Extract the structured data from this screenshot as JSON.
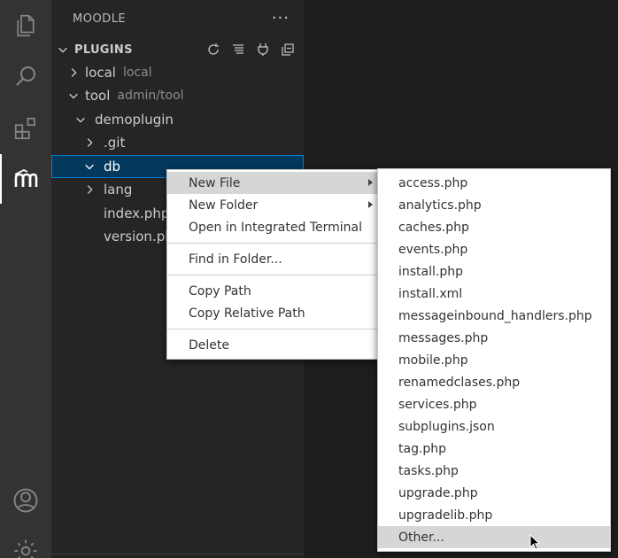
{
  "activity_bar": {
    "icons": [
      "explorer-icon",
      "search-icon",
      "extensions-icon",
      "moodle-icon",
      "account-icon",
      "settings-gear-icon"
    ]
  },
  "sidebar": {
    "title": "MOODLE",
    "more": "···",
    "section": {
      "title": "PLUGINS",
      "actions": [
        "refresh-icon",
        "collapse-all-icon",
        "plug-icon",
        "collapse-folders-icon"
      ]
    },
    "tree": [
      {
        "label": "local",
        "desc": "local"
      },
      {
        "label": "tool",
        "desc": "admin/tool"
      },
      {
        "label": "demoplugin",
        "desc": ""
      },
      {
        "label": ".git",
        "desc": ""
      },
      {
        "label": "db",
        "desc": ""
      },
      {
        "label": "lang",
        "desc": ""
      },
      {
        "label": "index.php",
        "desc": ""
      },
      {
        "label": "version.php",
        "desc": ""
      }
    ]
  },
  "context_menu": {
    "items": [
      {
        "label": "New File"
      },
      {
        "label": "New Folder"
      },
      {
        "label": "Open in Integrated Terminal"
      },
      {
        "label": "Find in Folder..."
      },
      {
        "label": "Copy Path"
      },
      {
        "label": "Copy Relative Path"
      },
      {
        "label": "Delete"
      }
    ]
  },
  "submenu": {
    "items": [
      "access.php",
      "analytics.php",
      "caches.php",
      "events.php",
      "install.php",
      "install.xml",
      "messageinbound_handlers.php",
      "messages.php",
      "mobile.php",
      "renamedclases.php",
      "services.php",
      "subplugins.json",
      "tag.php",
      "tasks.php",
      "upgrade.php",
      "upgradelib.php",
      "Other..."
    ]
  }
}
